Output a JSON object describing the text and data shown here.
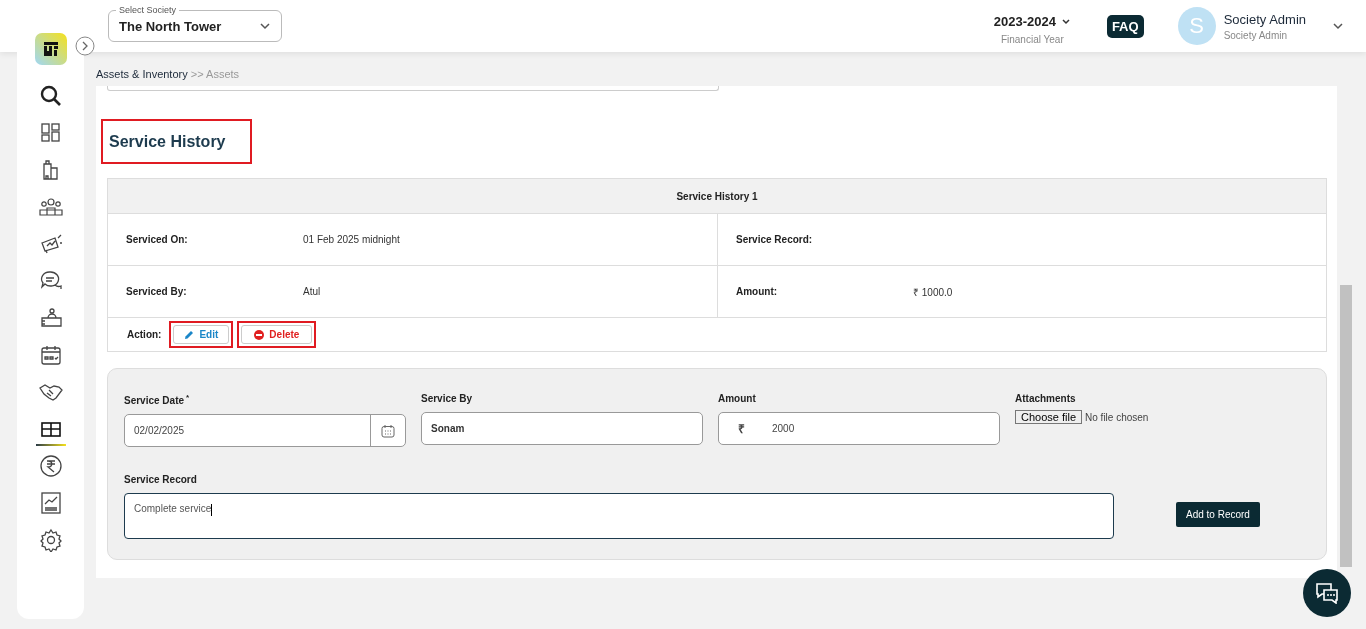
{
  "header": {
    "society_select": {
      "label": "Select Society",
      "value": "The North Tower"
    },
    "financial_year": {
      "value": "2023-2024",
      "label": "Financial Year"
    },
    "faq": "FAQ",
    "user": {
      "initial": "S",
      "name": "Society Admin",
      "role": "Society Admin"
    }
  },
  "sidebar": {
    "items": [
      {
        "selected": false
      },
      {
        "selected": false
      },
      {
        "selected": false
      },
      {
        "selected": false
      },
      {
        "selected": false
      },
      {
        "selected": false
      },
      {
        "selected": false
      },
      {
        "selected": false
      },
      {
        "selected": false
      },
      {
        "selected": true
      },
      {
        "selected": false
      },
      {
        "selected": false
      },
      {
        "selected": false
      }
    ]
  },
  "breadcrumb": {
    "parent": "Assets & Inventory",
    "current": ">> Assets"
  },
  "section": {
    "title": "Service History",
    "highlighted": true
  },
  "history": {
    "title": "Service History 1",
    "rows": [
      [
        {
          "label": "Serviced On:",
          "value": "01 Feb 2025 midnight"
        },
        {
          "label": "Service Record:"
        }
      ],
      [
        {
          "label": "Serviced By:",
          "value": "Atul"
        },
        {
          "label": "Amount:",
          "value": "₹ 1000.0"
        }
      ]
    ],
    "action_label": "Action:",
    "actions": [
      {
        "kind": "edit",
        "label": "Edit",
        "highlighted": true
      },
      {
        "kind": "delete",
        "label": "Delete",
        "highlighted": true
      }
    ]
  },
  "form": {
    "service_date": {
      "label": "Service Date",
      "required_mark": "*",
      "value": "02/02/2025"
    },
    "service_by": {
      "label": "Service By",
      "value": "Sonam"
    },
    "amount": {
      "label": "Amount",
      "currency": "₹",
      "value": "2000"
    },
    "attachments": {
      "label": "Attachments",
      "button": "Choose file",
      "status": "No file chosen"
    },
    "service_record": {
      "label": "Service Record",
      "value": "Complete service"
    },
    "submit": "Add to Record"
  }
}
